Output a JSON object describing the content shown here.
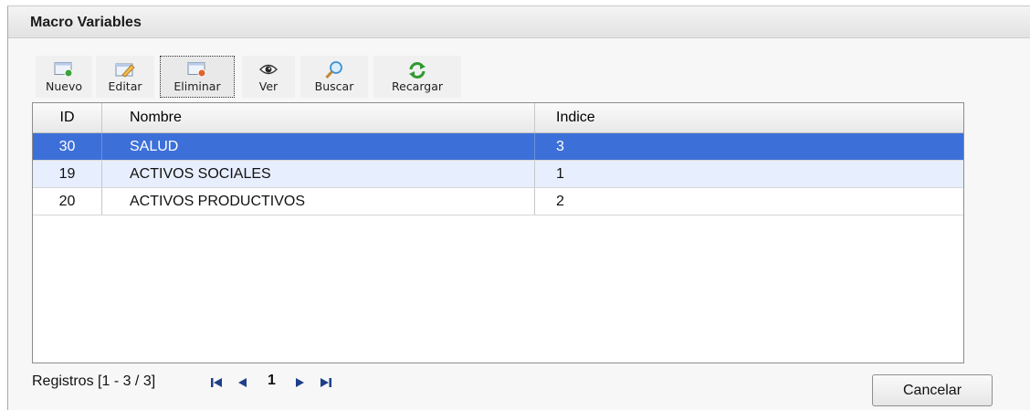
{
  "dialog": {
    "title": "Macro Variables"
  },
  "toolbar": {
    "new_label": "Nuevo",
    "edit_label": "Editar",
    "delete_label": "Eliminar",
    "view_label": "Ver",
    "search_label": "Buscar",
    "reload_label": "Recargar"
  },
  "grid": {
    "columns": [
      "ID",
      "Nombre",
      "Indice"
    ],
    "rows": [
      {
        "id": "30",
        "nombre": "SALUD",
        "indice": "3"
      },
      {
        "id": "19",
        "nombre": "ACTIVOS SOCIALES",
        "indice": "1"
      },
      {
        "id": "20",
        "nombre": "ACTIVOS PRODUCTIVOS",
        "indice": "2"
      }
    ],
    "selected_row": 0
  },
  "pager": {
    "records_text": "Registros [1 - 3 / 3]",
    "page": "1"
  },
  "footer": {
    "cancel_label": "Cancelar"
  },
  "colors": {
    "selection": "#3d6fd8",
    "alt_row": "#e7efff"
  }
}
